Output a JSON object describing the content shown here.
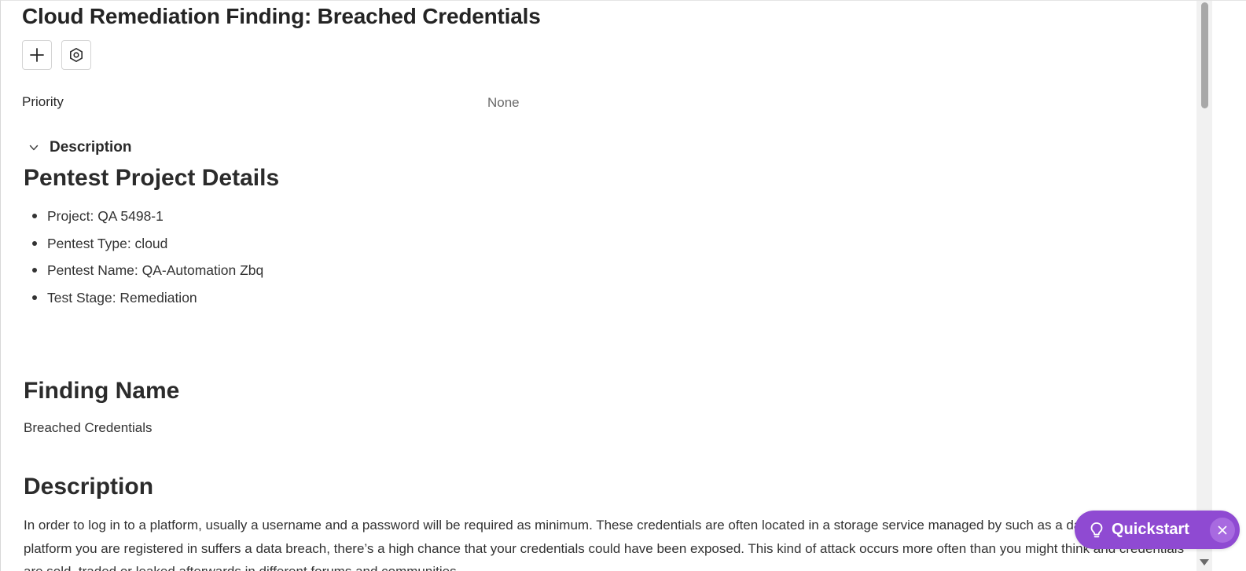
{
  "header": {
    "title": "Cloud Remediation Finding: Breached Credentials"
  },
  "toolbar": {
    "add_icon": "plus-icon",
    "settings_icon": "hexagon-settings-icon"
  },
  "fields": {
    "priority_label": "Priority",
    "priority_value": "None"
  },
  "description_section": {
    "toggle_label": "Description",
    "toggle_icon": "chevron-down-icon"
  },
  "body": {
    "project_heading": "Pentest Project Details",
    "project_items": [
      "Project: QA 5498-1",
      "Pentest Type: cloud",
      "Pentest Name: QA-Automation Zbq",
      "Test Stage: Remediation"
    ],
    "finding_heading": "Finding Name",
    "finding_name": "Breached Credentials",
    "description_heading": "Description",
    "description_text": "In order to log in to a platform, usually a username and a password will be required as minimum. These credentials are often located in a storage service managed by such as a database. If a platform you are registered in suffers a data breach, there’s a high chance that your credentials could have been exposed. This kind of attack occurs more often than you might think and credentials are sold, traded or leaked afterwards in different forums and communities."
  },
  "quickstart": {
    "label": "Quickstart",
    "icon": "lightbulb-icon",
    "close_icon": "close-icon",
    "color": "#8f4ad2"
  }
}
